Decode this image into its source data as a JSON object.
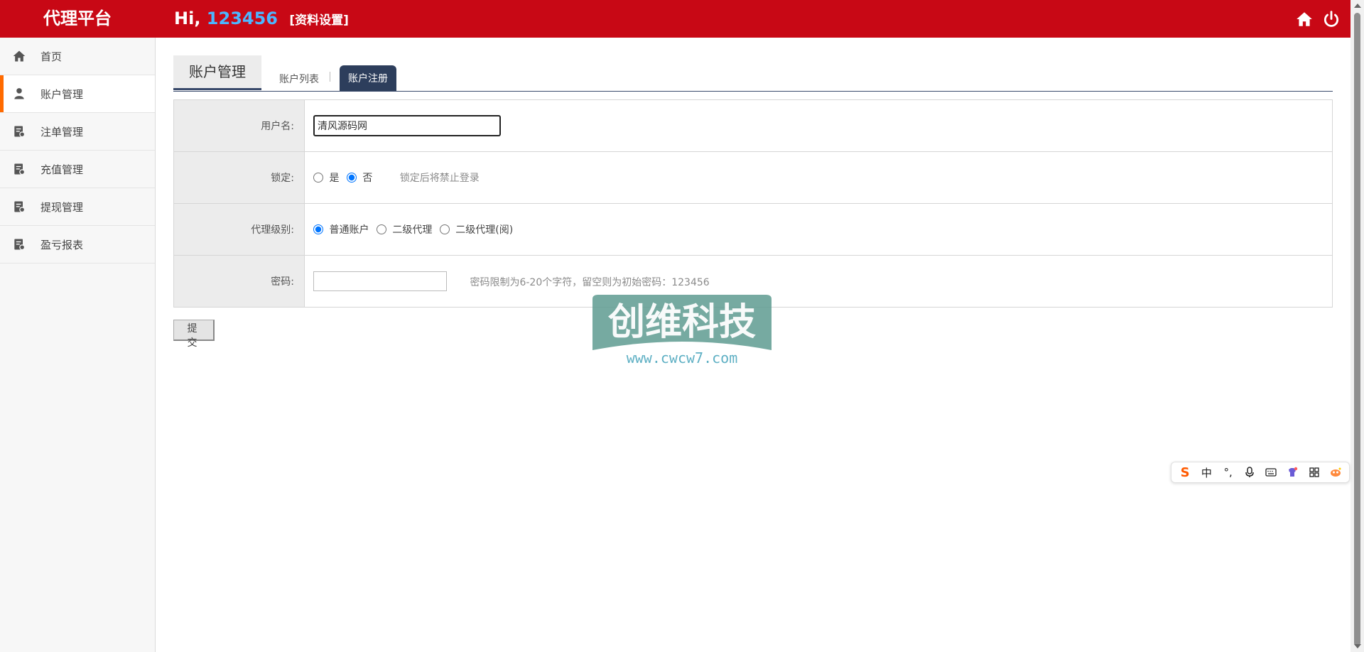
{
  "header": {
    "brand": "代理平台",
    "greeting": "Hi,",
    "username": "123456",
    "profile_link": "[资料设置]",
    "icons": [
      "home-icon",
      "power-icon"
    ]
  },
  "sidebar": {
    "items": [
      {
        "label": "首页",
        "icon": "home-icon",
        "active": false
      },
      {
        "label": "账户管理",
        "icon": "user-icon",
        "active": true
      },
      {
        "label": "注单管理",
        "icon": "document-icon",
        "active": false
      },
      {
        "label": "充值管理",
        "icon": "document-icon",
        "active": false
      },
      {
        "label": "提现管理",
        "icon": "document-icon",
        "active": false
      },
      {
        "label": "盈亏报表",
        "icon": "document-icon",
        "active": false
      }
    ]
  },
  "main": {
    "section_title": "账户管理",
    "tabs": [
      {
        "label": "账户列表",
        "active": false
      },
      {
        "label": "账户注册",
        "active": true
      }
    ],
    "form": {
      "username": {
        "label": "用户名:",
        "value": "清风源码网"
      },
      "lock": {
        "label": "锁定:",
        "options": [
          "是",
          "否"
        ],
        "selected": "否",
        "hint": "锁定后将禁止登录"
      },
      "level": {
        "label": "代理级别:",
        "options": [
          "普通账户",
          "二级代理",
          "二级代理(阅)"
        ],
        "selected": "普通账户"
      },
      "password": {
        "label": "密码:",
        "value": "",
        "hint": "密码限制为6-20个字符，留空则为初始密码：123456"
      },
      "submit_label": "提 交"
    }
  },
  "watermark": {
    "title": "创维科技",
    "url": "www.cwcw7.com"
  },
  "ime_toolbar": {
    "items": [
      "sogou-logo-icon",
      "中",
      "punctuation-icon",
      "microphone-icon",
      "keyboard-icon",
      "skin-icon",
      "grid-icon",
      "mascot-icon"
    ]
  },
  "colors": {
    "header_bg": "#c80815",
    "username": "#4cb6ff",
    "active_tab": "#2d3e5c",
    "sidebar_active_marker": "#ff6a00"
  }
}
